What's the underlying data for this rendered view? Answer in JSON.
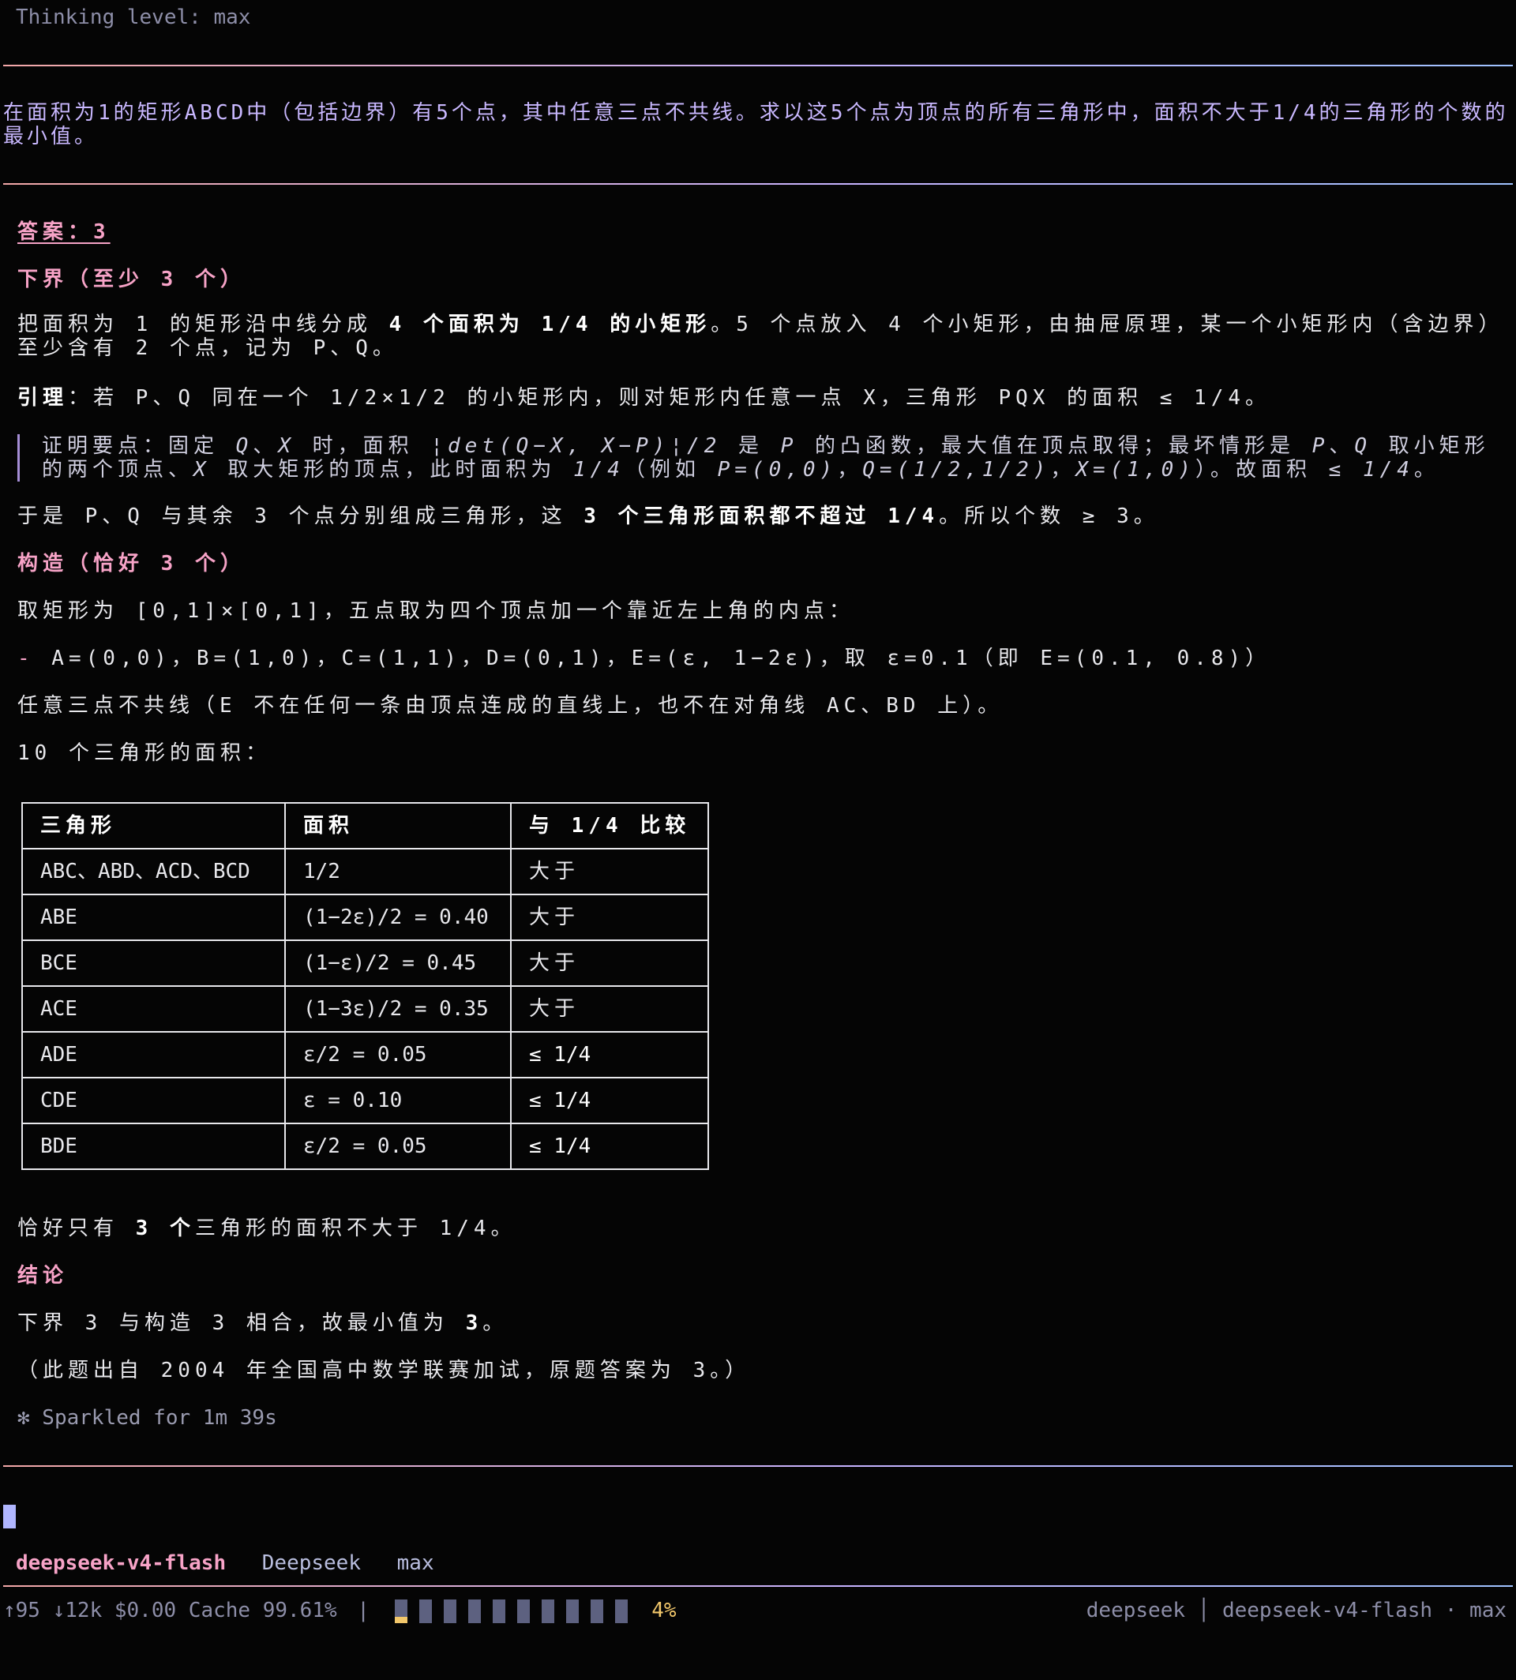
{
  "header": {
    "thinking_level": "Thinking level: max"
  },
  "question": "在面积为1的矩形ABCD中（包括边界）有5个点，其中任意三点不共线。求以这5个点为顶点的所有三角形中，面积不大于1/4的三角形的个数的最小值。",
  "answer": {
    "title": "答案：3",
    "lower_heading": "下界（至少 3 个）",
    "lower_p1": "把面积为 1 的矩形沿中线分成 ",
    "lower_p1_bold": "4 个面积为 1/4 的小矩形",
    "lower_p1_rest": "。5 个点放入 4 个小矩形，由抽屉原理，某一个小矩形内（含边界）至少含有 2 个点，记为 P、Q。",
    "lemma_label": "引理",
    "lemma_text": "：若 P、Q 同在一个 1/2×1/2 的小矩形内，则对矩形内任意一点 X，三角形 PQX 的面积 ≤ 1/4。",
    "proof_a": "证明要点：固定 ",
    "proof_b": "Q",
    "proof_c": "、",
    "proof_d": "X",
    "proof_e": " 时，面积 ",
    "proof_f": "¦det(Q−X, X−P)¦/2",
    "proof_g": " 是 ",
    "proof_h": "P",
    "proof_i": " 的凸函数，最大值在顶点取得；最坏情形是 ",
    "proof_j": "P",
    "proof_k": "、",
    "proof_l": "Q",
    "proof_m": " 取小矩形的两个顶点、",
    "proof_n": "X",
    "proof_o": " 取大矩形的顶点，此时面积为 ",
    "proof_p": "1/4",
    "proof_q": "（例如 ",
    "proof_r": "P=(0,0)",
    "proof_s": "，",
    "proof_t": "Q=(1/2,1/2)",
    "proof_u": "，",
    "proof_v": "X=(1,0)",
    "proof_w": "）。故面积 ",
    "proof_x": "≤ 1/4",
    "proof_y": "。",
    "so_a": "于是 P、Q 与其余 3 个点分别组成三角形，这 ",
    "so_b": "3 个三角形面积都不超过 1/4",
    "so_c": "。所以个数 ≥ 3。",
    "construct_heading": "构造（恰好 3 个）",
    "construct_p1": "取矩形为 [0,1]×[0,1]，五点取为四个顶点加一个靠近左上角的内点：",
    "construct_dash": "-",
    "construct_points": " A=(0,0)，B=(1,0)，C=(1,1)，D=(0,1)，E=(ε, 1−2ε)，取 ε=0.1（即 E=(0.1, 0.8)）",
    "construct_p2": "任意三点不共线（E 不在任何一条由顶点连成的直线上，也不在对角线 AC、BD 上）。",
    "construct_p3": "10 个三角形的面积：",
    "table": {
      "headers": [
        "三角形",
        "面积",
        "与 1/4 比较"
      ],
      "rows": [
        [
          "ABC、ABD、ACD、BCD",
          "1/2",
          "大于"
        ],
        [
          "ABE",
          "(1−2ε)/2 = 0.40",
          "大于"
        ],
        [
          "BCE",
          "(1−ε)/2 = 0.45",
          "大于"
        ],
        [
          "ACE",
          "(1−3ε)/2 = 0.35",
          "大于"
        ],
        [
          "ADE",
          "ε/2 = 0.05",
          "≤ 1/4"
        ],
        [
          "CDE",
          "ε = 0.10",
          "≤ 1/4"
        ],
        [
          "BDE",
          "ε/2 = 0.05",
          "≤ 1/4"
        ]
      ]
    },
    "exact_a": "恰好只有 ",
    "exact_b": "3 个",
    "exact_c": "三角形的面积不大于 1/4。",
    "conclusion_heading": "结论",
    "conclusion_a": "下界 3 与构造 3 相合，故最小值为 ",
    "conclusion_b": "3",
    "conclusion_c": "。",
    "source": "（此题出自 2004 年全国高中数学联赛加试，原题答案为 3。）",
    "sparkled": "✻ Sparkled for 1m 39s"
  },
  "model_line": {
    "model": "deepseek-v4-flash",
    "provider": "Deepseek",
    "level": "max"
  },
  "status": {
    "stats": "↑95 ↓12k $0.00 Cache 99.61%",
    "sep": "|",
    "context_percent": "4%",
    "context_fraction": 0.04,
    "right": "deepseek │ deepseek-v4-flash · max"
  },
  "colors": {
    "accent_pink": "#f7a3c7",
    "question_purple": "#c9b8ff",
    "bar_yellow": "#f2c76b"
  }
}
